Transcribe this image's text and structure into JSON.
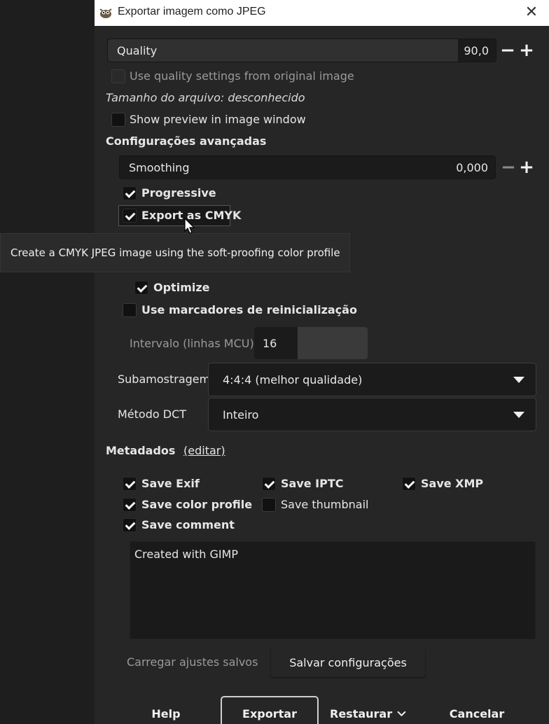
{
  "window": {
    "title": "Exportar imagem como JPEG",
    "close_glyph": "✕"
  },
  "quality": {
    "label": "Quality",
    "value": "90,0",
    "fraction": 0.9
  },
  "use_original_quality": {
    "label": "Use quality settings from original image",
    "checked": false
  },
  "file_size": "Tamanho do arquivo: desconhecido",
  "show_preview": {
    "label": "Show preview in image window",
    "checked": false
  },
  "advanced": {
    "heading": "Configurações avançadas",
    "smoothing": {
      "label": "Smoothing",
      "value": "0,000"
    },
    "progressive": {
      "label": "Progressive",
      "checked": true
    },
    "export_cmyk": {
      "label": "Export as CMYK",
      "checked": true
    },
    "tooltip": "Create a CMYK JPEG image using the soft-proofing color profile",
    "optimize": {
      "label": "Optimize",
      "checked": true
    },
    "restart_markers": {
      "label": "Use marcadores de reinicialização",
      "checked": false
    },
    "interval": {
      "label": "Intervalo (linhas MCU):",
      "value": "16"
    },
    "subsampling": {
      "label": "Subamostragem",
      "value": "4:4:4 (melhor qualidade)"
    },
    "dct": {
      "label": "Método DCT",
      "value": "Inteiro"
    }
  },
  "metadata": {
    "heading": "Metadados",
    "edit_link": "(editar)",
    "save_exif": {
      "label": "Save Exif",
      "checked": true
    },
    "save_iptc": {
      "label": "Save IPTC",
      "checked": true
    },
    "save_xmp": {
      "label": "Save XMP",
      "checked": true
    },
    "save_color_profile": {
      "label": "Save color profile",
      "checked": true
    },
    "save_thumbnail": {
      "label": "Save thumbnail",
      "checked": false
    },
    "save_comment": {
      "label": "Save comment",
      "checked": true
    },
    "comment_text": "Created with GIMP"
  },
  "settings": {
    "load_label": "Carregar ajustes salvos",
    "save_label": "Salvar configurações"
  },
  "buttons": {
    "help": "Help",
    "export": "Exportar",
    "reset": "Restaurar",
    "cancel": "Cancelar"
  },
  "icons": {
    "plus": "+",
    "minus": "−"
  },
  "colors": {
    "dialog_bg": "#262626",
    "titlebar_bg": "#ffffff",
    "field_bg": "#1b1b1b"
  }
}
